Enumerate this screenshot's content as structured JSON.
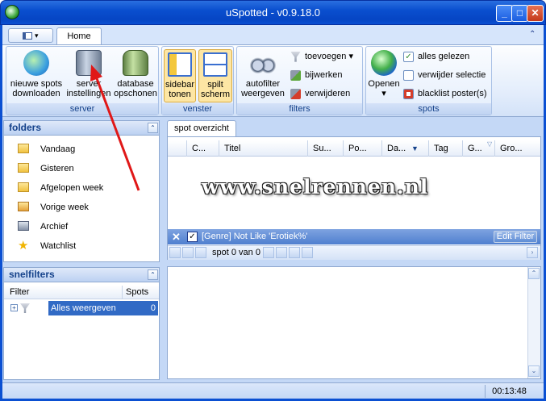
{
  "window": {
    "title": "uSpotted - v0.9.18.0"
  },
  "ribbon": {
    "tab_home": "Home",
    "groups": {
      "server": {
        "label": "server",
        "download_line1": "nieuwe spots",
        "download_line2": "downloaden",
        "settings_line1": "server",
        "settings_line2": "instellingen",
        "cleanup_line1": "database",
        "cleanup_line2": "opschonen"
      },
      "venster": {
        "label": "venster",
        "sidebar_line1": "sidebar",
        "sidebar_line2": "tonen",
        "split_line1": "spilt",
        "split_line2": "scherm"
      },
      "filters": {
        "label": "filters",
        "autofilter_line1": "autofilter",
        "autofilter_line2": "weergeven",
        "add": "toevoegen",
        "edit": "bijwerken",
        "remove": "verwijderen"
      },
      "spots": {
        "label": "spots",
        "open": "Openen",
        "read_all": "alles gelezen",
        "remove_selection": "verwijder selectie",
        "blacklist": "blacklist poster(s)"
      }
    }
  },
  "sidebar": {
    "folders_title": "folders",
    "folders": [
      {
        "label": "Vandaag",
        "icon": "folder-icon"
      },
      {
        "label": "Gisteren",
        "icon": "folder-icon"
      },
      {
        "label": "Afgelopen week",
        "icon": "folder-icon"
      },
      {
        "label": "Vorige week",
        "icon": "search-folder-icon"
      },
      {
        "label": "Archief",
        "icon": "archive-icon"
      },
      {
        "label": "Watchlist",
        "icon": "star-icon"
      }
    ],
    "snelfilters_title": "snelfilters",
    "snelfilters_header": {
      "filter": "Filter",
      "spots": "Spots"
    },
    "snelfilters_rows": [
      {
        "label": "Alles weergeven",
        "spots": "0"
      }
    ]
  },
  "main": {
    "tab": "spot overzicht",
    "columns": [
      "C...",
      "Titel",
      "Su...",
      "Po...",
      "Da...",
      "Tag",
      "G...",
      "Gro..."
    ],
    "watermark": "www.snelrennen.nl",
    "filter_text": "[Genre] Not Like 'Erotiek%'",
    "edit_filter": "Edit Filter",
    "pager_text": "spot 0 van 0"
  },
  "status": {
    "time": "00:13:48"
  },
  "colors": {
    "titlebar": "#0b50d2",
    "accent": "#15428b",
    "arrow": "#e01818"
  }
}
